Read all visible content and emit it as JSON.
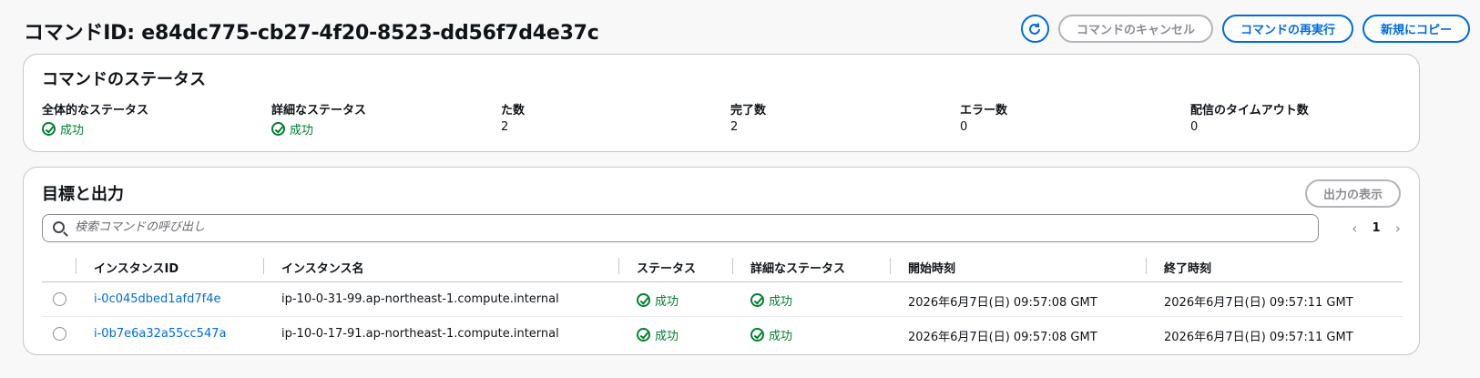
{
  "header": {
    "title": "コマンドID: e84dc775-cb27-4f20-8523-dd56f7d4e37c",
    "cancel_label": "コマンドのキャンセル",
    "rerun_label": "コマンドの再実行",
    "copy_label": "新規にコピー"
  },
  "status_card": {
    "title": "コマンドのステータス",
    "items": [
      {
        "label": "全体的なステータス",
        "value": "成功"
      },
      {
        "label": "詳細なステータス",
        "value": "成功"
      },
      {
        "label": "た数",
        "value": "2"
      },
      {
        "label": "完了数",
        "value": "2"
      },
      {
        "label": "エラー数",
        "value": "0"
      },
      {
        "label": "配信のタイムアウト数",
        "value": "0"
      }
    ]
  },
  "targets_card": {
    "title": "目標と出力",
    "show_output_label": "出力の表示",
    "search_placeholder": "検索コマンドの呼び出し",
    "page": "1",
    "columns": [
      "インスタンスID",
      "インスタンス名",
      "ステータス",
      "詳細なステータス",
      "開始時刻",
      "終了時刻"
    ],
    "rows": [
      {
        "instance_id": "i-0c045dbed1afd7f4e",
        "instance_name": "ip-10-0-31-99.ap-northeast-1.compute.internal",
        "status": "成功",
        "detailed_status": "成功",
        "start_time": "2026年6月7日(日) 09:57:08 GMT",
        "end_time": "2026年6月7日(日) 09:57:11 GMT"
      },
      {
        "instance_id": "i-0b7e6a32a55cc547a",
        "instance_name": "ip-10-0-17-91.ap-northeast-1.compute.internal",
        "status": "成功",
        "detailed_status": "成功",
        "start_time": "2026年6月7日(日) 09:57:08 GMT",
        "end_time": "2026年6月7日(日) 09:57:11 GMT"
      }
    ]
  },
  "colors": {
    "link": "#006ce0",
    "success": "#00802f",
    "disabled": "#8c8c94"
  }
}
